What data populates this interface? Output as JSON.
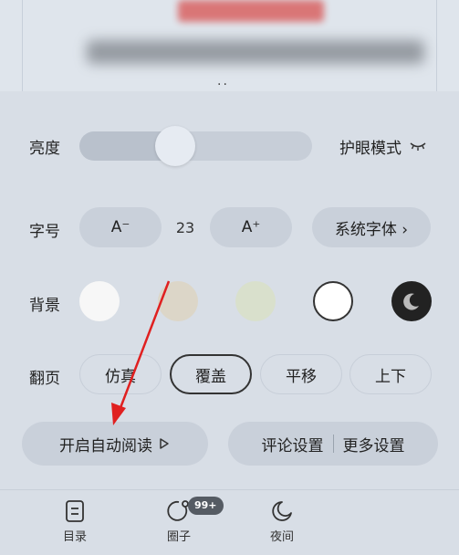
{
  "brightness": {
    "label": "亮度",
    "level": 0.41,
    "eye_mode_label": "护眼模式"
  },
  "font": {
    "label": "字号",
    "decrease_label": "A⁻",
    "size_value": "23",
    "increase_label": "A⁺",
    "system_font_label": "系统字体 ›"
  },
  "background": {
    "label": "背景",
    "swatches": [
      "#f7f7f7",
      "#dcd6c8",
      "#d9e0cc",
      "#ffffff",
      "#222222"
    ]
  },
  "page_turn": {
    "label": "翻页",
    "options": [
      "仿真",
      "覆盖",
      "平移",
      "上下"
    ],
    "selected": "覆盖"
  },
  "actions": {
    "auto_read_label": "开启自动阅读",
    "comment_settings_label": "评论设置",
    "more_settings_label": "更多设置"
  },
  "nav": {
    "catalog_label": "目录",
    "circle_label": "圈子",
    "circle_badge": "99+",
    "night_label": "夜间"
  },
  "colors": {
    "annotation_arrow": "#e02020"
  }
}
